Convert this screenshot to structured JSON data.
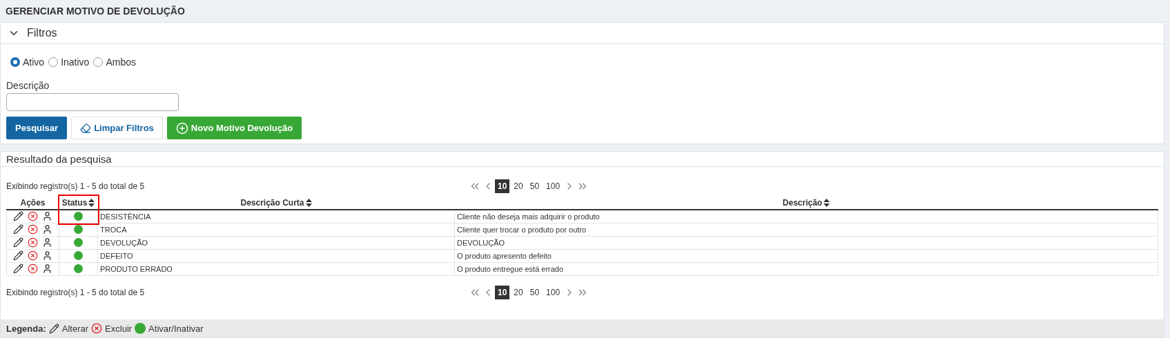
{
  "page_title": "GERENCIAR MOTIVO DE DEVOLUÇÃO",
  "filters": {
    "title": "Filtros",
    "expanded": true,
    "status_options": [
      {
        "label": "Ativo",
        "selected": true
      },
      {
        "label": "Inativo",
        "selected": false
      },
      {
        "label": "Ambos",
        "selected": false
      }
    ],
    "description_label": "Descrição",
    "buttons": [
      {
        "kind": "primary",
        "label": "Pesquisar"
      },
      {
        "kind": "clear",
        "label": "Limpar Filtros"
      },
      {
        "kind": "add",
        "label": "Novo Motivo Devolução"
      }
    ]
  },
  "results": {
    "title": "Resultado da pesquisa",
    "summary_top": "Exibindo registro(s) 1 - 5 do total de 5",
    "page_sizes_top": [
      {
        "label": "10",
        "selected": true
      },
      {
        "label": "20",
        "selected": false
      },
      {
        "label": "50",
        "selected": false
      },
      {
        "label": "100",
        "selected": false
      }
    ],
    "columns": [
      {
        "label": "Ações",
        "sortable": false
      },
      {
        "label": "Status",
        "sortable": true,
        "annotation": {
          "kind": "frame"
        }
      },
      {
        "label": "Descrição Curta",
        "sortable": true
      },
      {
        "label": "Descrição",
        "sortable": true
      }
    ],
    "rows": [
      {
        "active": true,
        "short": "DESISTÊNCIA",
        "description": "Cliente não deseja mais adquirir o produto"
      },
      {
        "active": true,
        "short": "TROCA",
        "description": "Cliente quer trocar o produto por outro"
      },
      {
        "active": true,
        "short": "DEVOLUÇÃO",
        "description": "DEVOLUÇÃO"
      },
      {
        "active": true,
        "short": "DEFEITO",
        "description": "O produto apresento defeito"
      },
      {
        "active": true,
        "short": "PRODUTO ERRADO",
        "description": "O produto entregue está errado"
      }
    ],
    "summary_bottom": "Exibindo registro(s) 1 - 5 do total de 5",
    "page_sizes_bottom": [
      {
        "label": "10",
        "selected": true
      },
      {
        "label": "20",
        "selected": false
      },
      {
        "label": "50",
        "selected": false
      },
      {
        "label": "100",
        "selected": false
      }
    ]
  },
  "legend": {
    "title": "Legenda:",
    "items": [
      {
        "kind": "edit",
        "label": "Alterar"
      },
      {
        "kind": "delete",
        "label": "Excluir"
      },
      {
        "kind": "toggle",
        "label": "Ativar/Inativar"
      }
    ]
  }
}
